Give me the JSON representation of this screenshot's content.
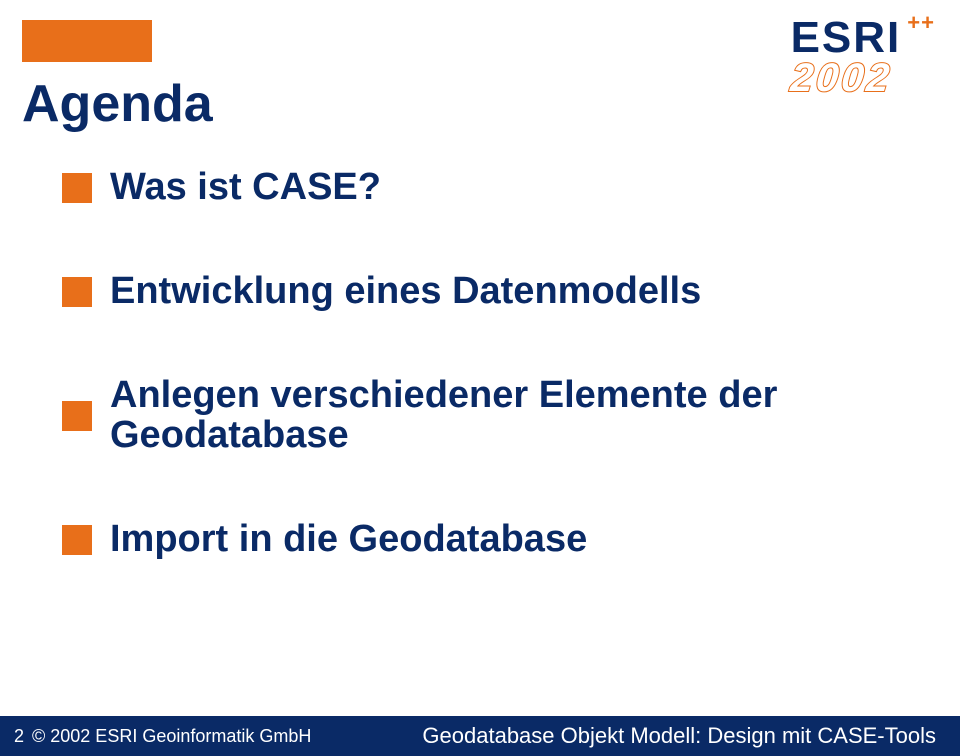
{
  "header": {
    "logo_text": "ESRI",
    "logo_pluses": "++",
    "logo_year": "2002"
  },
  "title": "Agenda",
  "bullets": [
    "Was ist CASE?",
    "Entwicklung eines Datenmodells",
    "Anlegen verschiedener Elemente der Geodatabase",
    "Import in die Geodatabase"
  ],
  "footer": {
    "page": "2",
    "copyright": "© 2002 ESRI Geoinformatik GmbH",
    "subject": "Geodatabase Objekt Modell: Design mit CASE-Tools"
  }
}
